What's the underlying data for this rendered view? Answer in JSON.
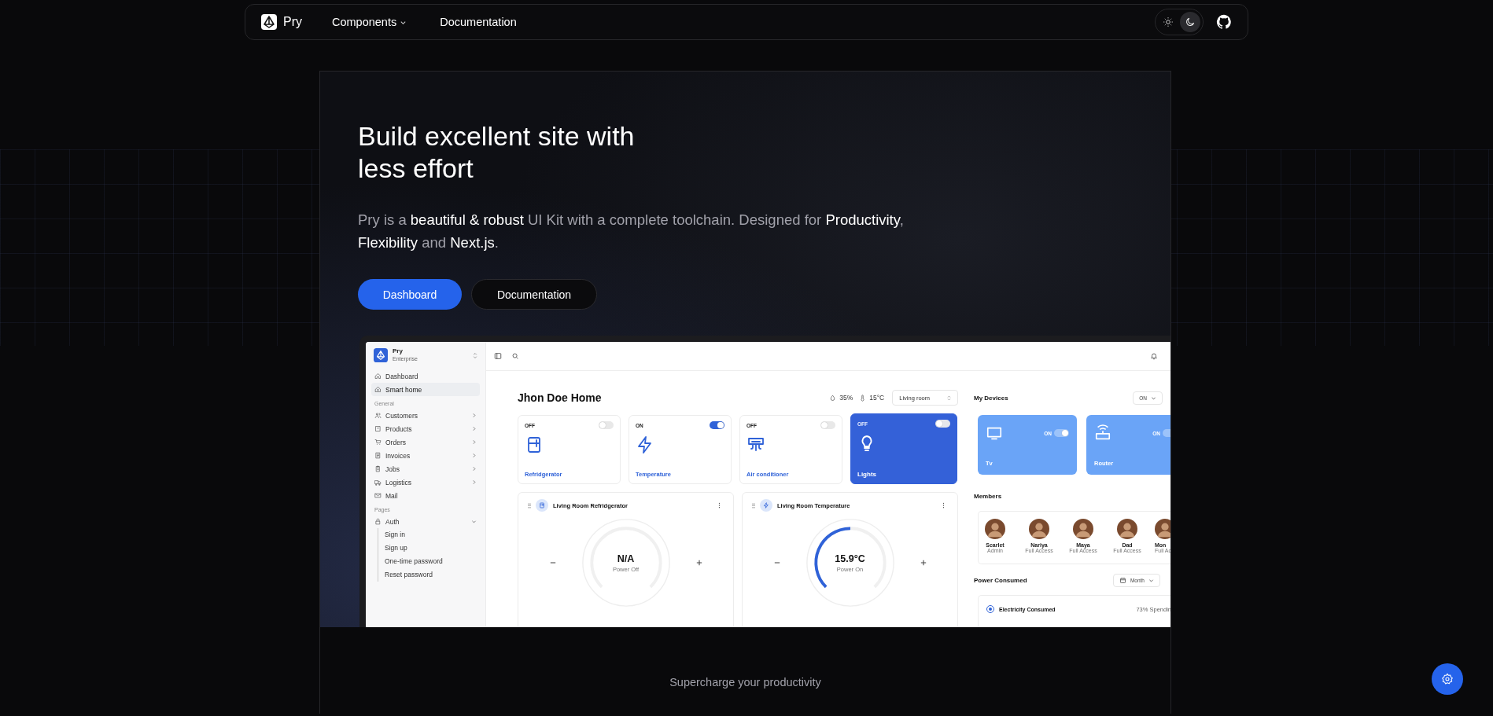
{
  "nav": {
    "brand": "Pry",
    "links": [
      {
        "label": "Components",
        "has_menu": true
      },
      {
        "label": "Documentation",
        "has_menu": false
      }
    ],
    "theme": [
      {
        "selected": false
      },
      {
        "selected": true
      }
    ]
  },
  "hero": {
    "title_lines": [
      "Build excellent site with",
      "less effort"
    ],
    "description": "Pry is a **beautiful & robust** UI Kit with a complete toolchain. Designed for **Productivity**, **Flexibility** and **Next.js**.",
    "buttons": [
      {
        "label": "Dashboard",
        "primary": true
      },
      {
        "label": "Documentation",
        "primary": false
      }
    ]
  },
  "dashboard": {
    "brand": {
      "name": "Pry",
      "plan": "Enterprise"
    },
    "sidebar": [
      {
        "kind": "link",
        "label": "Dashboard",
        "selected": false
      },
      {
        "kind": "link",
        "label": "Smart home",
        "selected": true
      },
      {
        "kind": "heading",
        "label": "General"
      },
      {
        "kind": "menu",
        "label": "Customers",
        "selected": false,
        "expanded": false
      },
      {
        "kind": "menu",
        "label": "Products",
        "selected": false,
        "expanded": false
      },
      {
        "kind": "menu",
        "label": "Orders",
        "selected": false,
        "expanded": false
      },
      {
        "kind": "menu",
        "label": "Invoices",
        "selected": false,
        "expanded": false
      },
      {
        "kind": "menu",
        "label": "Jobs",
        "selected": false,
        "expanded": false
      },
      {
        "kind": "menu",
        "label": "Logistics",
        "selected": false,
        "expanded": false
      },
      {
        "kind": "link",
        "label": "Mail",
        "selected": false
      },
      {
        "kind": "heading",
        "label": "Pages"
      },
      {
        "kind": "menu",
        "label": "Auth",
        "selected": false,
        "expanded": true,
        "children": [
          {
            "label": "Sign in"
          },
          {
            "label": "Sign up"
          },
          {
            "label": "One-time password"
          },
          {
            "label": "Reset password"
          }
        ]
      }
    ],
    "title": "Jhon Doe Home",
    "humidity": "35%",
    "temperature": "15°C",
    "room": "Living room",
    "devices": [
      {
        "status": "OFF",
        "on": false,
        "label": "Refridgerator",
        "selected": false
      },
      {
        "status": "ON",
        "on": true,
        "label": "Temperature",
        "selected": false
      },
      {
        "status": "OFF",
        "on": false,
        "label": "Air conditioner",
        "selected": false
      },
      {
        "status": "OFF",
        "on": false,
        "label": "Lights",
        "selected": true
      }
    ],
    "gauges": [
      {
        "title": "Living Room Refridgerator",
        "value": "N/A",
        "status": "Power Off"
      },
      {
        "title": "Living Room Temperature",
        "value": "15.9°C",
        "status": "Power On",
        "level": 0.5
      }
    ],
    "my_devices": {
      "title": "My Devices",
      "filter": "ON",
      "items": [
        {
          "label": "Tv",
          "status": "ON",
          "on": true
        },
        {
          "label": "Router",
          "status": "ON",
          "on": true
        }
      ]
    },
    "members": {
      "title": "Members",
      "items": [
        {
          "name": "Scarlet",
          "role": "Admin"
        },
        {
          "name": "Nariya",
          "role": "Full Access"
        },
        {
          "name": "Maya",
          "role": "Full Access"
        },
        {
          "name": "Dad",
          "role": "Full Access"
        },
        {
          "name": "Mon",
          "role": "Full Ac"
        }
      ]
    },
    "power": {
      "title": "Power Consumed",
      "period": "Month",
      "series": [
        {
          "label": "Electricity Consumed",
          "selected": true,
          "share": "73% Spendin"
        }
      ]
    }
  },
  "tagline": "Supercharge your productivity"
}
